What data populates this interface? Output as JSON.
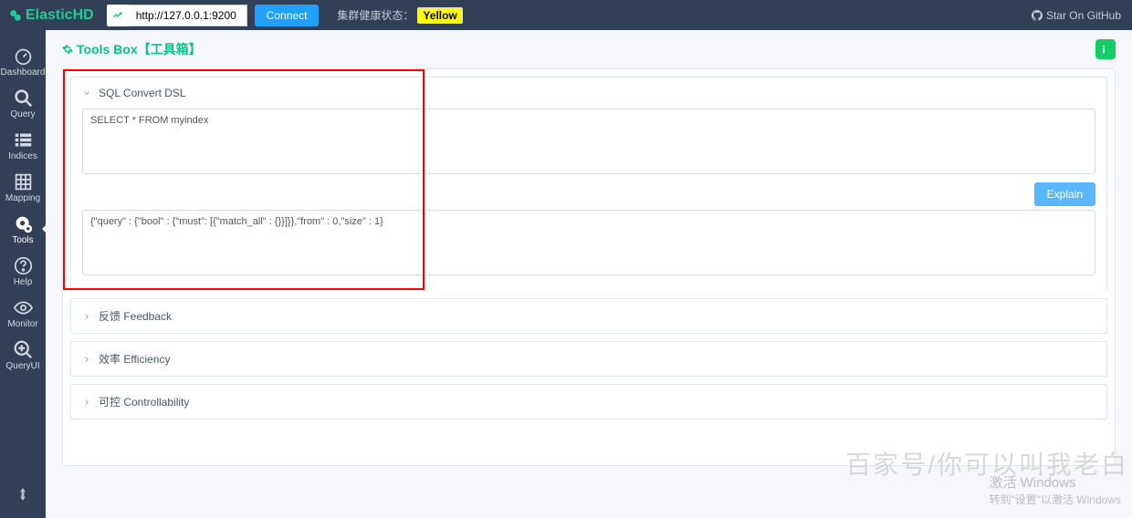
{
  "brand": "ElasticHD",
  "connectionUrl": "http://127.0.0.1:9200",
  "connectLabel": "Connect",
  "healthLabel": "集群健康状态：",
  "healthStatus": "Yellow",
  "githubLabel": "Star On GitHub",
  "sidebar": {
    "items": [
      {
        "label": "Dashboard"
      },
      {
        "label": "Query"
      },
      {
        "label": "Indices"
      },
      {
        "label": "Mapping"
      },
      {
        "label": "Tools"
      },
      {
        "label": "Help"
      },
      {
        "label": "Monitor"
      },
      {
        "label": "QueryUI"
      }
    ]
  },
  "page": {
    "title": "Tools Box【工具箱】"
  },
  "sections": {
    "sqlConvert": {
      "title": "SQL Convert DSL",
      "input": "SELECT * FROM myindex",
      "explainLabel": "Explain",
      "output": "{\"query\" : {\"bool\" : {\"must\": [{\"match_all\" : {}}]}},\"from\" : 0,\"size\" : 1}"
    },
    "feedback": {
      "title": "反馈 Feedback"
    },
    "efficiency": {
      "title": "效率 Efficiency"
    },
    "controllability": {
      "title": "可控 Controllability"
    }
  },
  "watermark": {
    "big": "百家号/你可以叫我老白",
    "line1": "激活 Windows",
    "line2": "转到\"设置\"以激活 Windows"
  }
}
